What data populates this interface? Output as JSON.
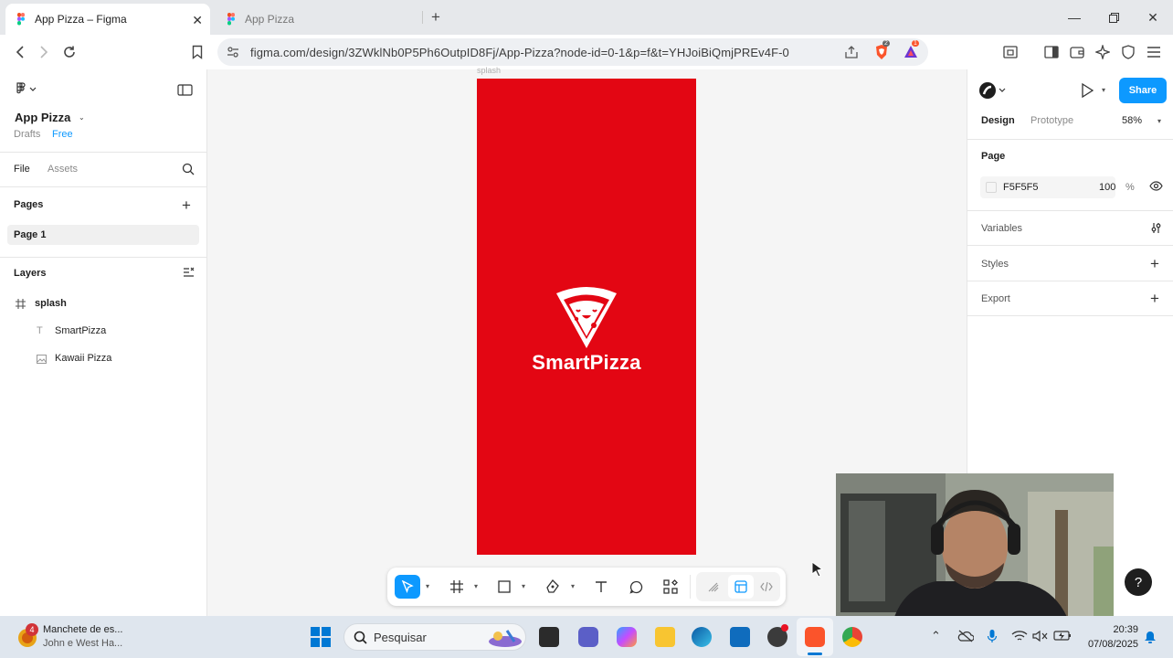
{
  "browser": {
    "tabs": [
      {
        "title": "App Pizza – Figma",
        "active": true
      },
      {
        "title": "App Pizza",
        "active": false
      }
    ],
    "new_tab_label": "+",
    "url": "figma.com/design/3ZWklNb0P5Ph6OutpID8Fj/App-Pizza?node-id=0-1&p=f&t=YHJoiBiQmjPREv4F-0",
    "shield_badge": "2",
    "extension_badge": "1"
  },
  "left_panel": {
    "file_name": "App Pizza",
    "location": "Drafts",
    "plan": "Free",
    "tabs": {
      "file": "File",
      "assets": "Assets"
    },
    "pages_heading": "Pages",
    "pages": [
      "Page 1"
    ],
    "layers_heading": "Layers",
    "layers": [
      {
        "name": "splash",
        "icon": "frame-icon",
        "depth": 0
      },
      {
        "name": "SmartPizza",
        "icon": "text-icon",
        "depth": 1
      },
      {
        "name": "Kawaii Pizza",
        "icon": "image-icon",
        "depth": 1
      }
    ]
  },
  "canvas": {
    "frame_label": "splash",
    "frame_color": "#e30613",
    "brand_text": "SmartPizza"
  },
  "right_panel": {
    "share_label": "Share",
    "tabs": {
      "design": "Design",
      "prototype": "Prototype"
    },
    "zoom": "58%",
    "page_heading": "Page",
    "page_color": "F5F5F5",
    "page_opacity": "100",
    "percent_sign": "%",
    "variables_label": "Variables",
    "styles_label": "Styles",
    "export_label": "Export"
  },
  "help_label": "?",
  "taskbar": {
    "news_badge": "4",
    "news_title": "Manchete de es...",
    "news_subtitle": "John e West Ha...",
    "search_placeholder": "Pesquisar",
    "time": "20:39",
    "date": "07/08/2025"
  },
  "colors": {
    "accent": "#0d99ff",
    "frame_red": "#e30613",
    "canvas_bg": "#f5f5f5"
  }
}
